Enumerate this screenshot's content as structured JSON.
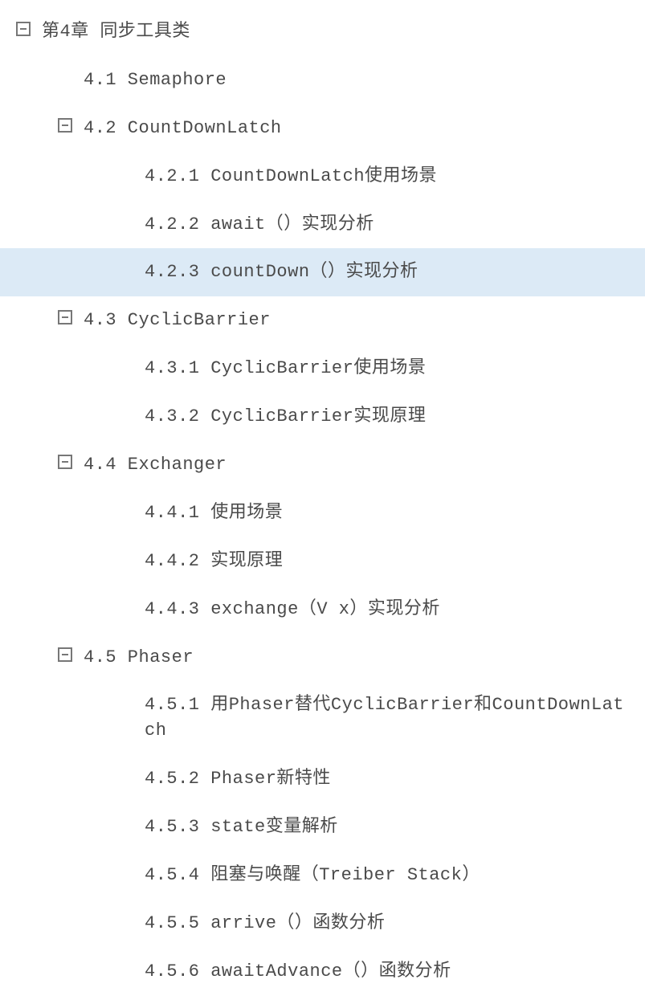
{
  "tree": [
    {
      "level": 0,
      "toggle": true,
      "text": "第4章 同步工具类",
      "selected": false
    },
    {
      "level": 1,
      "toggle": false,
      "text": "4.1 Semaphore",
      "selected": false
    },
    {
      "level": 1,
      "toggle": true,
      "text": "4.2 CountDownLatch",
      "selected": false
    },
    {
      "level": 2,
      "toggle": false,
      "text": "4.2.1 CountDownLatch使用场景",
      "selected": false
    },
    {
      "level": 2,
      "toggle": false,
      "text": "4.2.2 await（）实现分析",
      "selected": false
    },
    {
      "level": 2,
      "toggle": false,
      "text": "4.2.3 countDown（）实现分析",
      "selected": true
    },
    {
      "level": 1,
      "toggle": true,
      "text": "4.3 CyclicBarrier",
      "selected": false
    },
    {
      "level": 2,
      "toggle": false,
      "text": "4.3.1 CyclicBarrier使用场景",
      "selected": false
    },
    {
      "level": 2,
      "toggle": false,
      "text": "4.3.2 CyclicBarrier实现原理",
      "selected": false
    },
    {
      "level": 1,
      "toggle": true,
      "text": "4.4 Exchanger",
      "selected": false
    },
    {
      "level": 2,
      "toggle": false,
      "text": "4.4.1 使用场景",
      "selected": false
    },
    {
      "level": 2,
      "toggle": false,
      "text": "4.4.2 实现原理",
      "selected": false
    },
    {
      "level": 2,
      "toggle": false,
      "text": "4.4.3 exchange（V x）实现分析",
      "selected": false
    },
    {
      "level": 1,
      "toggle": true,
      "text": "4.5 Phaser",
      "selected": false
    },
    {
      "level": 2,
      "toggle": false,
      "text": "4.5.1 用Phaser替代CyclicBarrier和CountDownLatch",
      "selected": false
    },
    {
      "level": 2,
      "toggle": false,
      "text": "4.5.2 Phaser新特性",
      "selected": false
    },
    {
      "level": 2,
      "toggle": false,
      "text": "4.5.3 state变量解析",
      "selected": false
    },
    {
      "level": 2,
      "toggle": false,
      "text": "4.5.4 阻塞与唤醒（Treiber Stack）",
      "selected": false
    },
    {
      "level": 2,
      "toggle": false,
      "text": "4.5.5 arrive（）函数分析",
      "selected": false
    },
    {
      "level": 2,
      "toggle": false,
      "text": "4.5.6 awaitAdvance（）函数分析",
      "selected": false
    }
  ]
}
